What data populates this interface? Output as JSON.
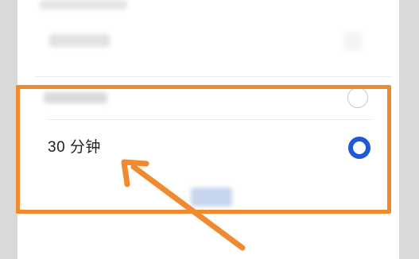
{
  "options": [
    {
      "label": "30 分钟",
      "selected": true
    }
  ],
  "colors": {
    "accent": "#1e58d6",
    "highlight": "#f08a2e",
    "divider": "#ececec",
    "unselected_radio": "#c8c8c8"
  }
}
